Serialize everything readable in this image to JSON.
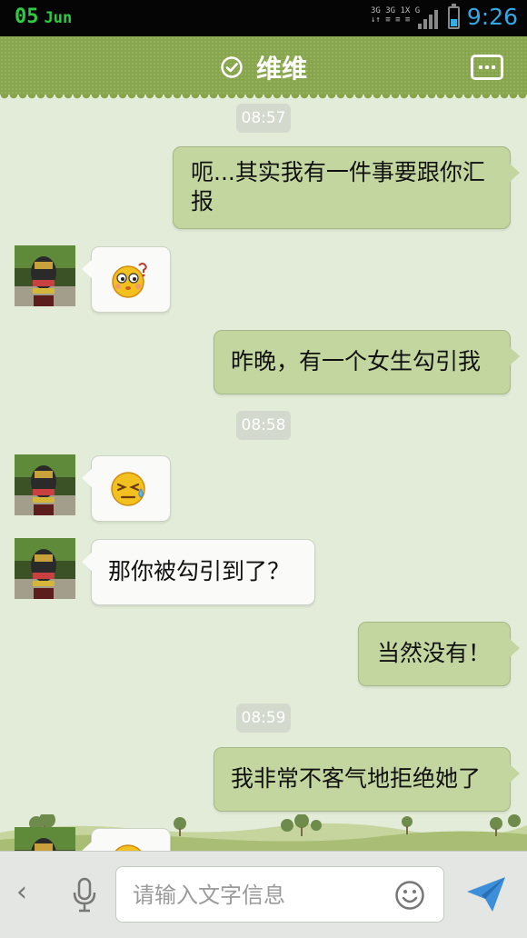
{
  "status_bar": {
    "day": "05",
    "month": "Jun",
    "net_top": "3G 3G 1X G",
    "net_bottom": "↓↑ ≡ ≡ ≡",
    "time": "9:26"
  },
  "header": {
    "title": "维维"
  },
  "messages": [
    {
      "type": "time",
      "text": "08:57"
    },
    {
      "type": "text",
      "from": "me",
      "lines": [
        "呃...其实我有一件事要跟你汇",
        "报"
      ]
    },
    {
      "type": "emoji",
      "from": "them",
      "emoji": "confused-face-emoji"
    },
    {
      "type": "text",
      "from": "me",
      "lines": [
        "昨晚，有一个女生勾引我"
      ]
    },
    {
      "type": "time",
      "text": "08:58"
    },
    {
      "type": "emoji",
      "from": "them",
      "emoji": "sweat-face-emoji"
    },
    {
      "type": "text",
      "from": "them",
      "lines": [
        "那你被勾引到了？"
      ]
    },
    {
      "type": "text",
      "from": "me",
      "lines": [
        "当然没有！"
      ]
    },
    {
      "type": "time",
      "text": "08:59"
    },
    {
      "type": "text",
      "from": "me",
      "lines": [
        "我非常不客气地拒绝她了"
      ]
    },
    {
      "type": "emoji",
      "from": "them",
      "emoji": "face-emoji"
    }
  ],
  "input": {
    "placeholder": "请输入文字信息",
    "value": ""
  },
  "icons": {
    "back": "chevron-left-icon",
    "mic": "microphone-icon",
    "emoji": "smiley-icon",
    "send": "paper-plane-icon",
    "verified": "check-circle-icon",
    "menu": "more-icon"
  },
  "colors": {
    "header": "#86a54a",
    "my_bubble": "#c3d6a0",
    "their_bubble": "#fafbf8",
    "background": "#e3ecd8",
    "status_time": "#32a8e8",
    "status_date": "#2ecc40"
  }
}
